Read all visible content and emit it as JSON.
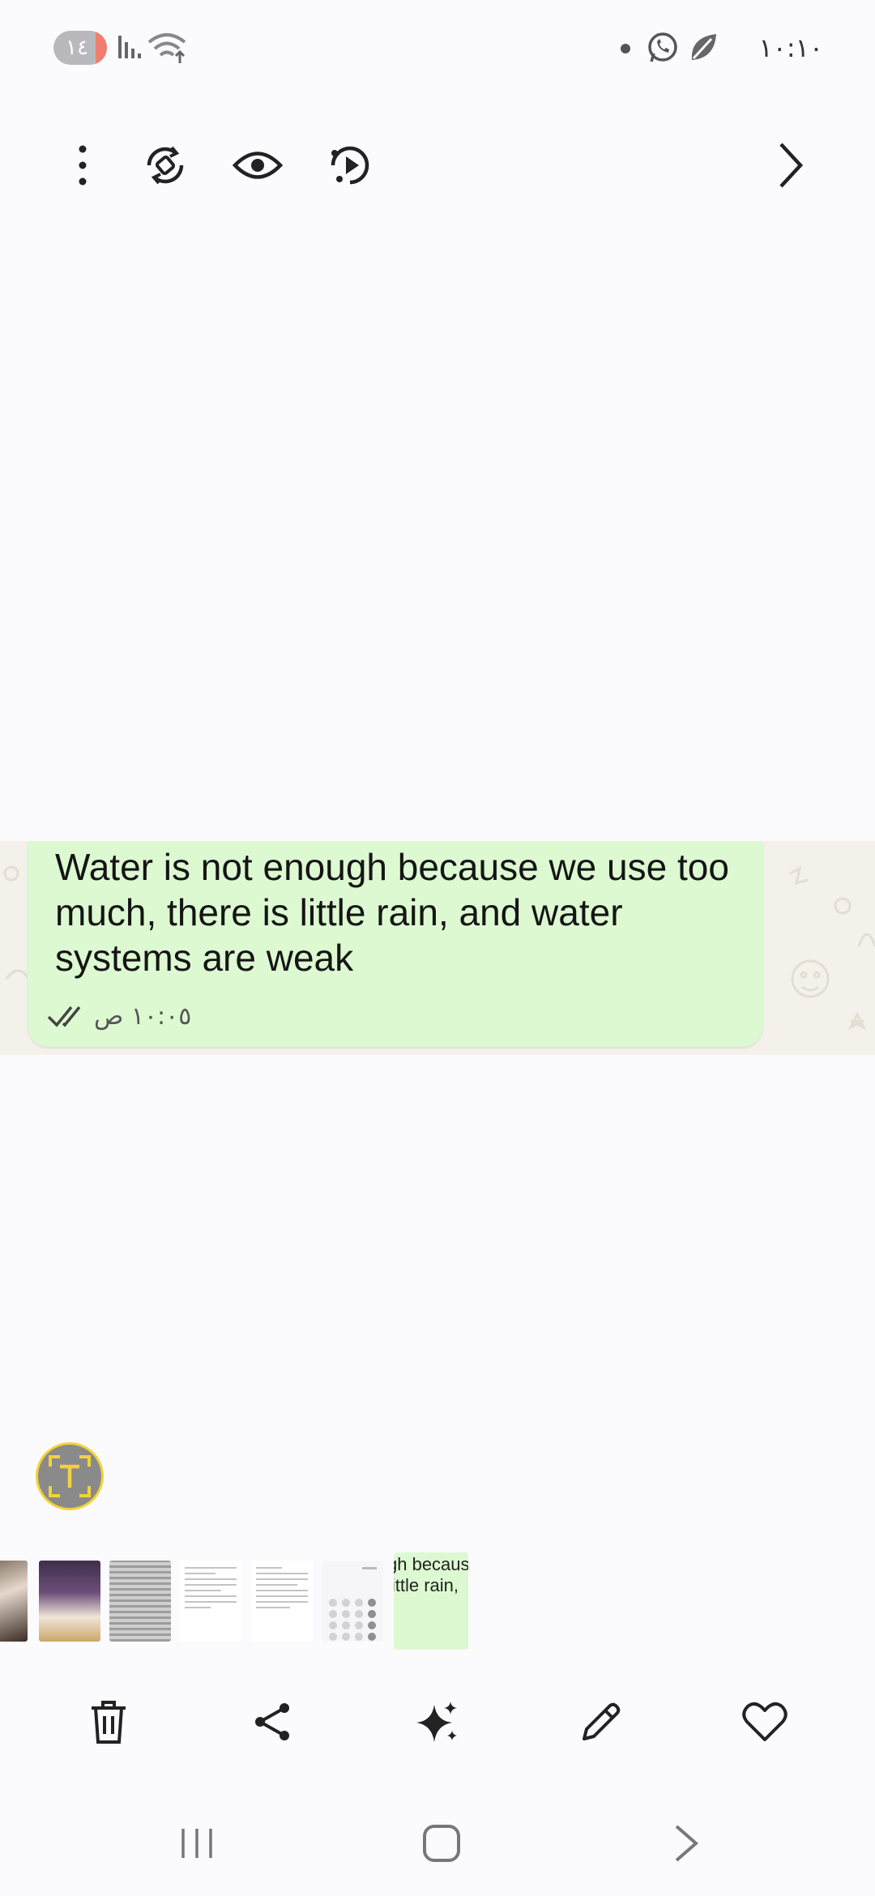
{
  "status_bar": {
    "battery": "١٤",
    "clock": "١٠:١٠"
  },
  "toolbar": {
    "icons": [
      "more-vertical-icon",
      "rotate-icon",
      "eye-icon",
      "replay-icon",
      "chevron-right-icon"
    ]
  },
  "message": {
    "text": "Water is not enough because we use too much, there is little rain, and water systems are weak",
    "time": "١٠:٠٥ ص",
    "status": "read"
  },
  "filmstrip": {
    "selected_preview_text": "gh becaus\nlittle rain,"
  },
  "actions": [
    "delete",
    "share",
    "enhance",
    "edit",
    "favorite"
  ],
  "colors": {
    "bubble": "#ddf9d2",
    "scan_border": "#f2d23c",
    "background": "#fbfbfe"
  }
}
